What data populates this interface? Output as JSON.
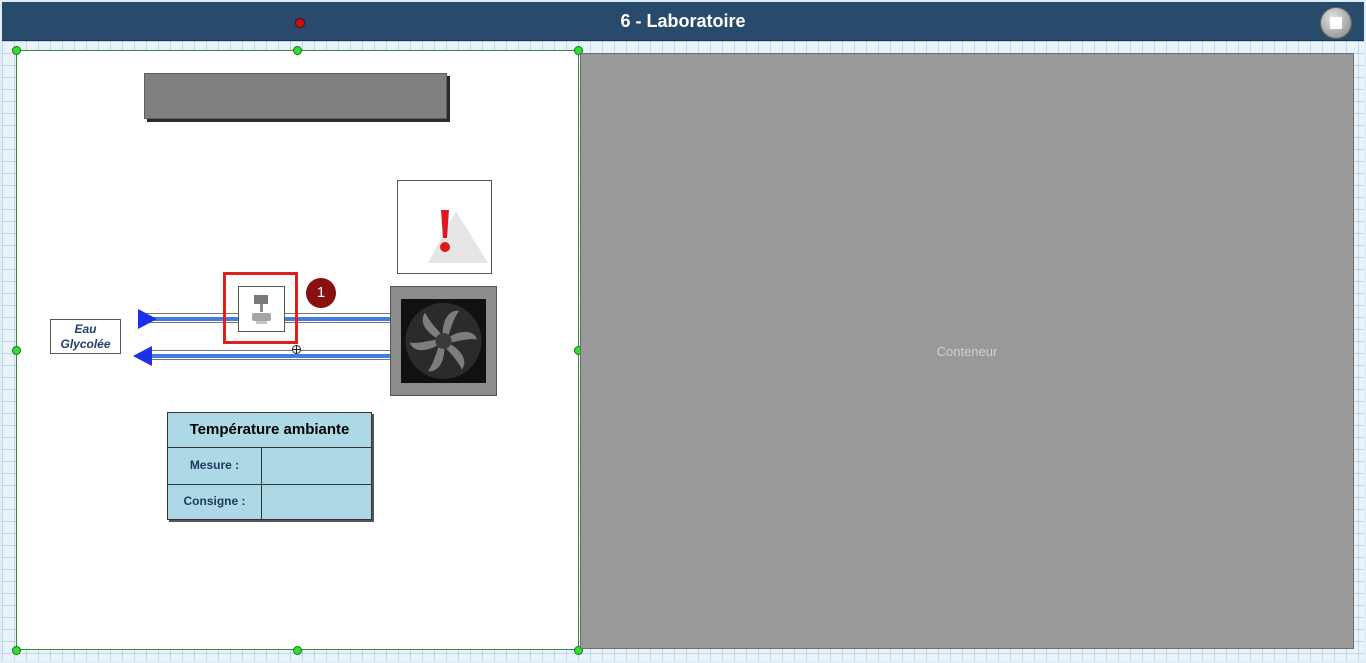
{
  "window": {
    "title": "6 - Laboratoire"
  },
  "diagram": {
    "fluid_label_line1": "Eau",
    "fluid_label_line2": "Glycolée",
    "callout_number": "1",
    "temperature_panel": {
      "title": "Température ambiante",
      "rows": [
        {
          "label": "Mesure :",
          "value": ""
        },
        {
          "label": "Consigne :",
          "value": ""
        }
      ]
    }
  },
  "container": {
    "label": "Conteneur"
  },
  "colors": {
    "titlebar": "#284b6b",
    "pipe_flow": "#3f7fe0",
    "arrow": "#1a2fe6",
    "highlight": "#e02020",
    "table_bg": "#add8e6",
    "container_bg": "#999999",
    "handle": "#33dd33"
  },
  "icons": [
    "alarm-warning-icon",
    "valve-icon",
    "fan-icon",
    "stop-icon",
    "crosshair-icon"
  ]
}
